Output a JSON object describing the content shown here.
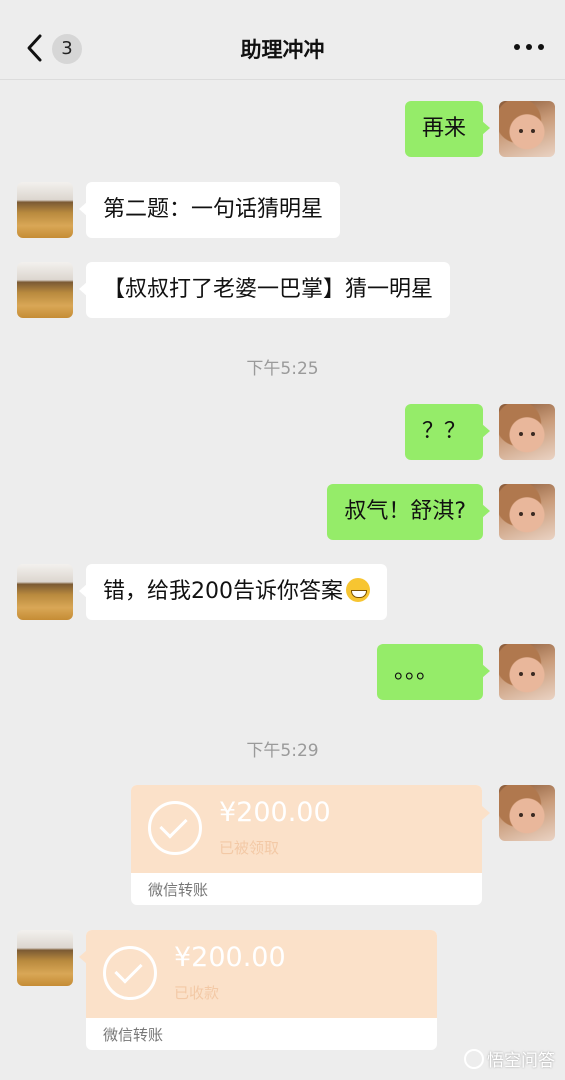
{
  "header": {
    "back_count": "3",
    "title": "助理冲冲"
  },
  "messages": {
    "m1": "再来",
    "m2": "第二题：一句话猜明星",
    "m3": "【叔叔打了老婆一巴掌】猜一明星",
    "time1": "下午5:25",
    "m4": "？？",
    "m5": "叔气！舒淇?",
    "m6": "错，给我200告诉你答案",
    "m7": "。。。",
    "time2": "下午5:29"
  },
  "transfers": {
    "sent": {
      "amount": "¥200.00",
      "status": "已被领取",
      "label": "微信转账"
    },
    "received": {
      "amount": "¥200.00",
      "status": "已收款",
      "label": "微信转账"
    }
  },
  "watermark": "悟空问答",
  "colors": {
    "my_bubble": "#95ec69",
    "other_bubble": "#ffffff",
    "transfer": "#fbe1c9",
    "background": "#ededed"
  },
  "icons": {
    "back": "chevron-left-icon",
    "more": "more-dots-icon",
    "emoji": "grin-emoji-icon",
    "transfer": "check-circle-icon"
  }
}
